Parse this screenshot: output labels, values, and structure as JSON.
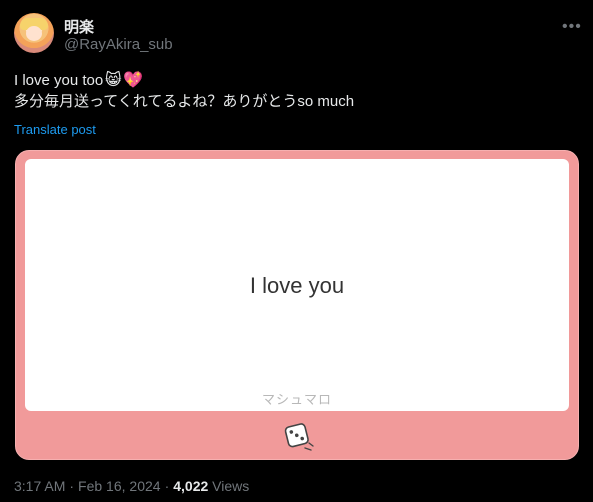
{
  "author": {
    "display_name": "明楽",
    "handle": "@RayAkira_sub"
  },
  "post": {
    "line1": "I love you too",
    "line1_emojis": [
      "😸",
      "💖"
    ],
    "line2": "多分毎月送ってくれてるよね？ありがとうso much",
    "translate_label": "Translate post"
  },
  "card": {
    "message": "I love you",
    "brand": "マシュマロ",
    "icon": "dice-icon"
  },
  "meta": {
    "time": "3:17 AM",
    "separator": "·",
    "date": "Feb 16, 2024",
    "views_count": "4,022",
    "views_label": "Views"
  },
  "colors": {
    "background": "#000000",
    "text": "#e7e9ea",
    "muted": "#71767b",
    "link": "#1d9bf0",
    "card_pink": "#f19a9a"
  }
}
